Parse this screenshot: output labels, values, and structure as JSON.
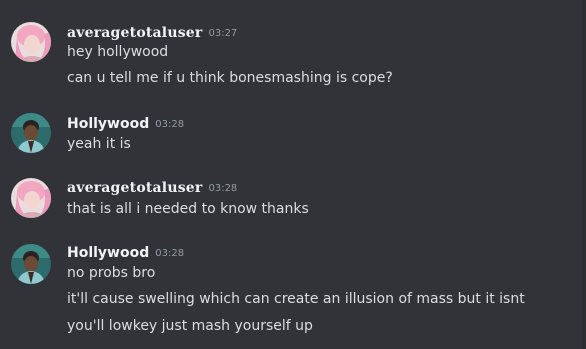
{
  "messages": [
    {
      "author": "averagetotaluser",
      "time": "03:27",
      "lines": [
        "hey hollywood",
        "can u tell me if u think bonesmashing is cope?"
      ]
    },
    {
      "author": "Hollywood",
      "time": "03:28",
      "lines": [
        "yeah it is"
      ]
    },
    {
      "author": "averagetotaluser",
      "time": "03:28",
      "lines": [
        "that is all i needed to know thanks"
      ]
    },
    {
      "author": "Hollywood",
      "time": "03:28",
      "lines": [
        "no probs bro",
        "it'll cause swelling which can create an illusion of mass but it isnt",
        "you'll lowkey just mash yourself up"
      ]
    }
  ]
}
